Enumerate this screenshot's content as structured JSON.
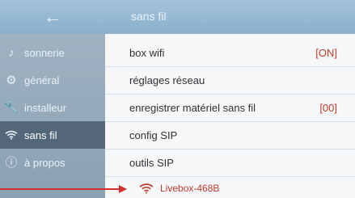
{
  "header": {
    "back_icon": "back-arrow-icon",
    "title": "sans fil"
  },
  "sidebar": {
    "items": [
      {
        "label": "sonnerie",
        "icon": "music-note-icon"
      },
      {
        "label": "général",
        "icon": "gear-icon"
      },
      {
        "label": "installeur",
        "icon": "wrench-icon"
      },
      {
        "label": "sans fil",
        "icon": "wifi-icon",
        "active": true
      },
      {
        "label": "à propos",
        "icon": "info-icon"
      }
    ]
  },
  "main": {
    "rows": [
      {
        "label": "box wifi",
        "value": "[ON]"
      },
      {
        "label": "réglages réseau",
        "value": ""
      },
      {
        "label": "enregistrer matériel sans fil",
        "value": "[00]"
      },
      {
        "label": "config SIP",
        "value": ""
      },
      {
        "label": "outils SIP",
        "value": ""
      }
    ],
    "wifi_network": {
      "name": "Livebox-468B",
      "icon": "wifi-icon"
    }
  },
  "colors": {
    "accent_red": "#c0392b",
    "topbar": "#95b6cf",
    "sidebar": "#93a8b9",
    "sidebar_active": "#53667a"
  }
}
